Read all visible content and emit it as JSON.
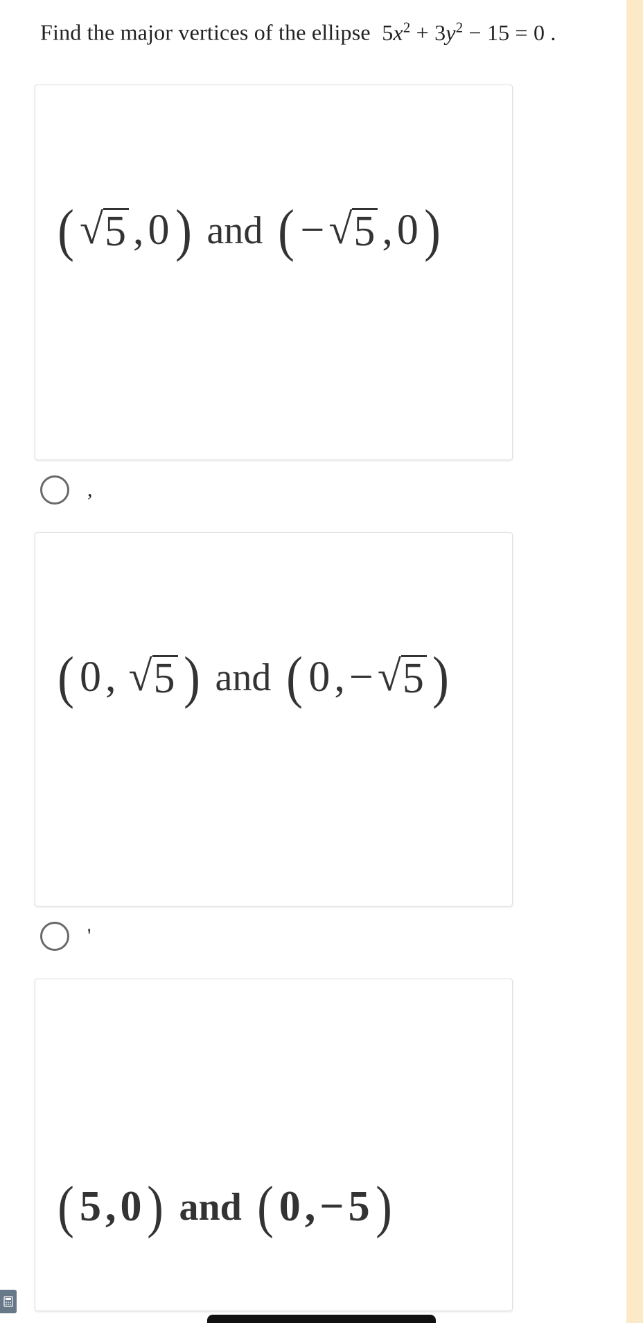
{
  "question": {
    "prefix": "Find the major vertices of the ellipse",
    "equation_parts": {
      "t1": "5",
      "var1": "x",
      "exp1": "2",
      "plus": " + ",
      "t2": "3",
      "var2": "y",
      "exp2": "2",
      "rest": " − 15 = 0 ."
    }
  },
  "options": [
    {
      "id": "opt-a",
      "label": ",",
      "lp1": "(",
      "v1a_sqrt": "5",
      "v1a_comma": ",",
      "v1a_y": "0",
      "rp1": ")",
      "and": "and",
      "lp2": "(",
      "v2a_neg": "−",
      "v2a_sqrt": "5",
      "v2a_comma": ",",
      "v2a_y": "0",
      "rp2": ")"
    },
    {
      "id": "opt-b",
      "label": "'",
      "lp1": "(",
      "v1b_x": "0",
      "v1b_comma": ",",
      "v1b_sqrt": "5",
      "rp1": ")",
      "and": "and",
      "lp2": "(",
      "v2b_x": "0",
      "v2b_comma": ",",
      "v2b_neg": "−",
      "v2b_sqrt": "5",
      "rp2": ")"
    },
    {
      "id": "opt-c",
      "label": "",
      "lp1": "(",
      "v1c_x": "5",
      "v1c_comma": ",",
      "v1c_y": "0",
      "rp1": ")",
      "and": "and",
      "lp2": "(",
      "v2c_x": "0",
      "v2c_comma": ",",
      "v2c_neg": "−",
      "v2c_y": "5",
      "rp2": ")"
    }
  ],
  "chart_data": {
    "type": "table",
    "title": "Multiple-choice question — major vertices of ellipse 5x^2 + 3y^2 − 15 = 0",
    "question": "Find the major vertices of the ellipse 5x^2 + 3y^2 − 15 = 0.",
    "choices": [
      {
        "key": "A",
        "text": "(√5, 0) and (−√5, 0)",
        "selected": false
      },
      {
        "key": "B",
        "text": "(0, √5) and (0, −√5)",
        "selected": false
      },
      {
        "key": "C",
        "text": "(5, 0) and (0, −5)",
        "selected": false
      }
    ]
  }
}
